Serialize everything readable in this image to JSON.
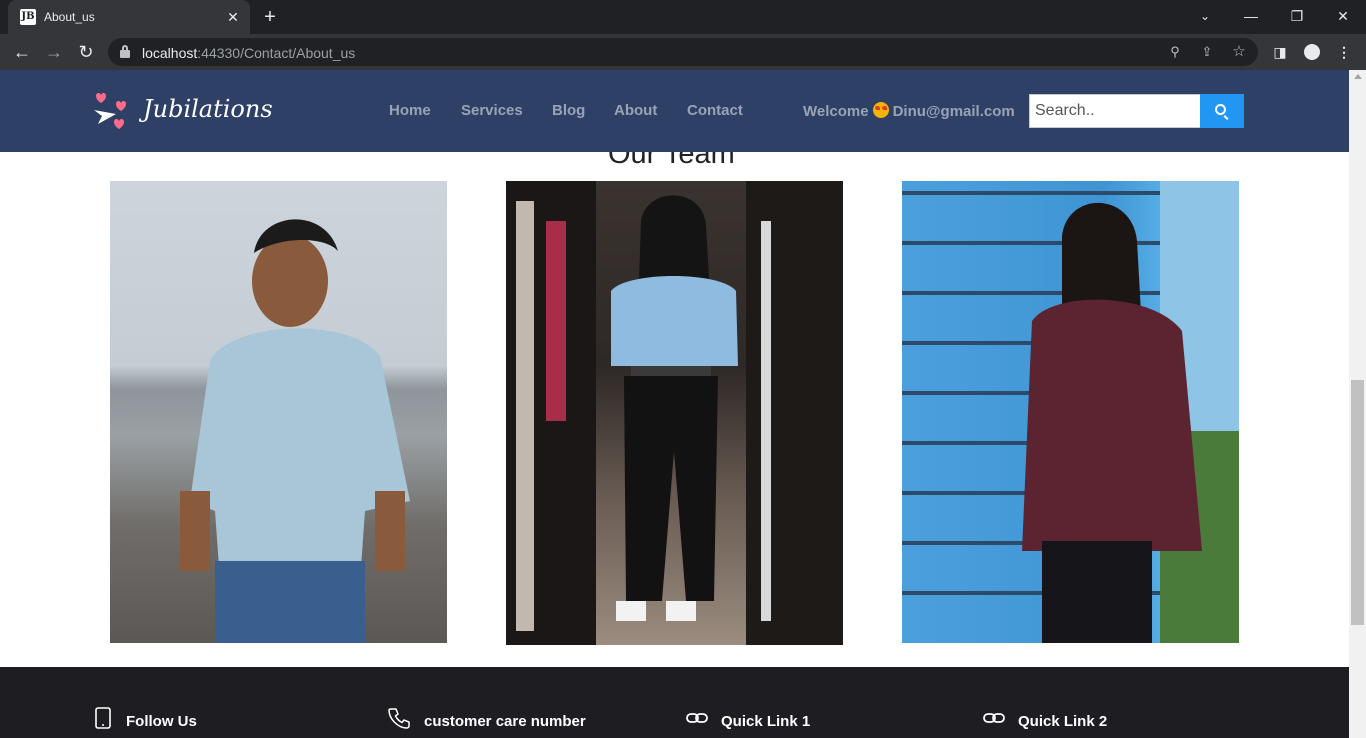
{
  "browser": {
    "tab_title": "About_us",
    "favicon_text": "JB",
    "url_host": "localhost",
    "url_rest": ":44330/Contact/About_us"
  },
  "header": {
    "logo_text": "Jubilations",
    "nav": [
      "Home",
      "Services",
      "Blog",
      "About",
      "Contact"
    ],
    "welcome_prefix": "Welcome",
    "user_email": "Dinu@gmail.com",
    "search_placeholder": "Search.."
  },
  "team": {
    "title": "Our Team"
  },
  "footer": {
    "items": [
      "Follow Us",
      "customer care number",
      "Quick Link 1",
      "Quick Link 2"
    ]
  },
  "colors": {
    "header_bg": "#2e4066",
    "search_button": "#2196f3",
    "footer_bg": "#1e1e22"
  }
}
